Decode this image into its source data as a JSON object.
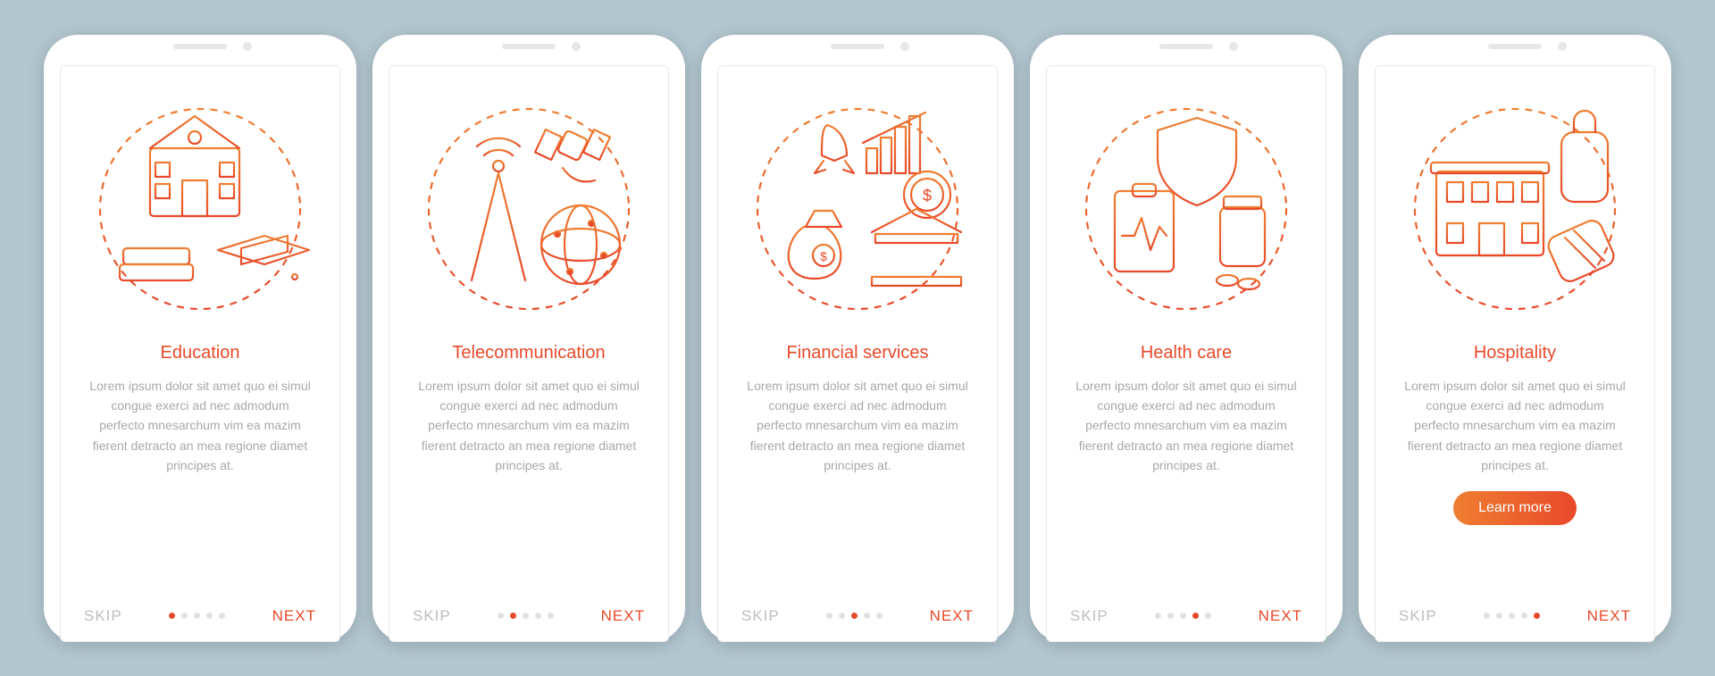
{
  "lorem": "Lorem ipsum dolor sit amet quo ei simul congue exerci ad nec admodum perfecto mnesarchum vim ea mazim fierent detracto an mea regione diamet principes at.",
  "slides": [
    {
      "title": "Education",
      "skip": "SKIP",
      "next": "NEXT",
      "active": 0,
      "learnMore": false
    },
    {
      "title": "Telecommunication",
      "skip": "SKIP",
      "next": "NEXT",
      "active": 1,
      "learnMore": false
    },
    {
      "title": "Financial services",
      "skip": "SKIP",
      "next": "NEXT",
      "active": 2,
      "learnMore": false
    },
    {
      "title": "Health care",
      "skip": "SKIP",
      "next": "NEXT",
      "active": 3,
      "learnMore": false
    },
    {
      "title": "Hospitality",
      "skip": "SKIP",
      "next": "NEXT",
      "active": 4,
      "learnMore": true,
      "learnMoreLabel": "Learn more"
    }
  ],
  "totalDots": 5,
  "colors": {
    "accent": "#e8492a",
    "gradientStart": "#ef7e31",
    "gradientEnd": "#e8492a"
  }
}
